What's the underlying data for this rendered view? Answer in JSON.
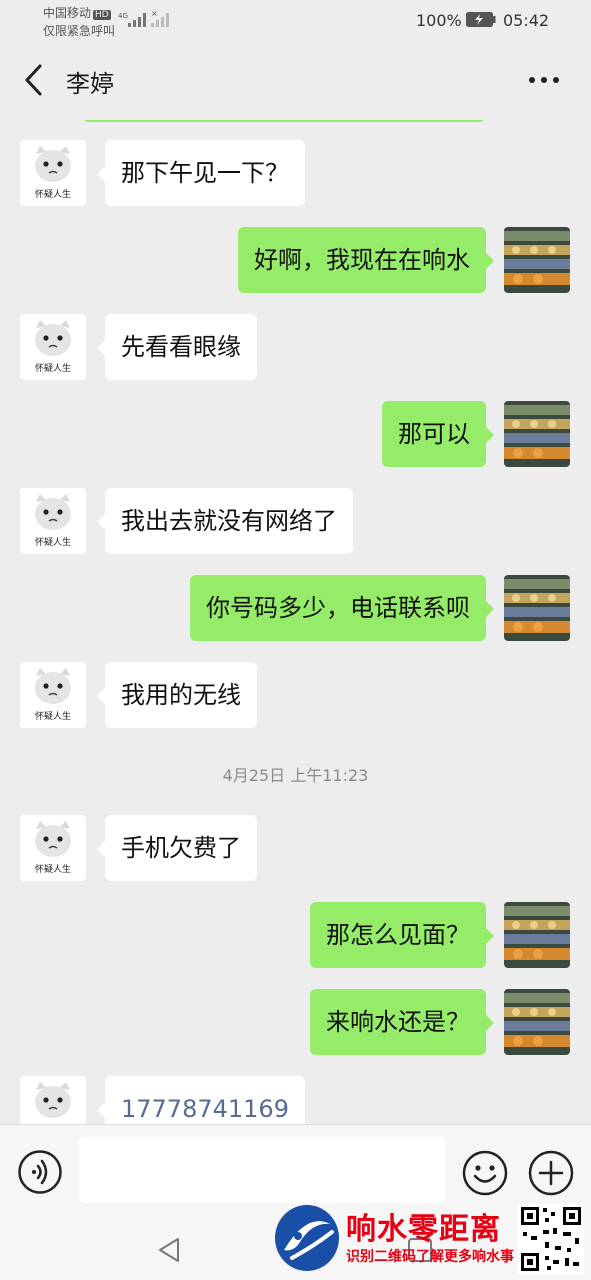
{
  "status_bar": {
    "carrier_line1": "中国移动",
    "hd_badge": "HD",
    "carrier_line2": "仅限紧急呼叫",
    "network": "4G",
    "battery_percent": "100%",
    "time": "05:42"
  },
  "header": {
    "title": "李婷",
    "back_icon": "chevron-left-icon",
    "more_icon": "more-dots-icon"
  },
  "avatar_caption": "怀疑人生",
  "messages": [
    {
      "side": "left",
      "text": "那下午见一下？"
    },
    {
      "side": "right",
      "text": "好啊，我现在在响水"
    },
    {
      "side": "left",
      "text": "先看看眼缘"
    },
    {
      "side": "right",
      "text": "那可以"
    },
    {
      "side": "left",
      "text": "我出去就没有网络了"
    },
    {
      "side": "right",
      "text": "你号码多少，电话联系呗"
    },
    {
      "side": "left",
      "text": "我用的无线"
    },
    {
      "side": "left",
      "text": "手机欠费了"
    },
    {
      "side": "right",
      "text": "那怎么见面？"
    },
    {
      "side": "right",
      "text": "来响水还是？"
    },
    {
      "side": "left",
      "text": "17778741169"
    }
  ],
  "timestamp": "4月25日 上午11:23",
  "input_bar": {
    "placeholder": "",
    "voice_icon": "voice-icon",
    "emoji_icon": "emoji-icon",
    "plus_icon": "plus-icon"
  },
  "watermark": {
    "title": "响水零距离",
    "subtitle": "识别二维码了解更多响水事"
  },
  "colors": {
    "background": "#ededed",
    "sent_bubble": "#95ec69",
    "received_bubble": "#ffffff",
    "link": "#576b95",
    "watermark_red": "#e60012"
  }
}
